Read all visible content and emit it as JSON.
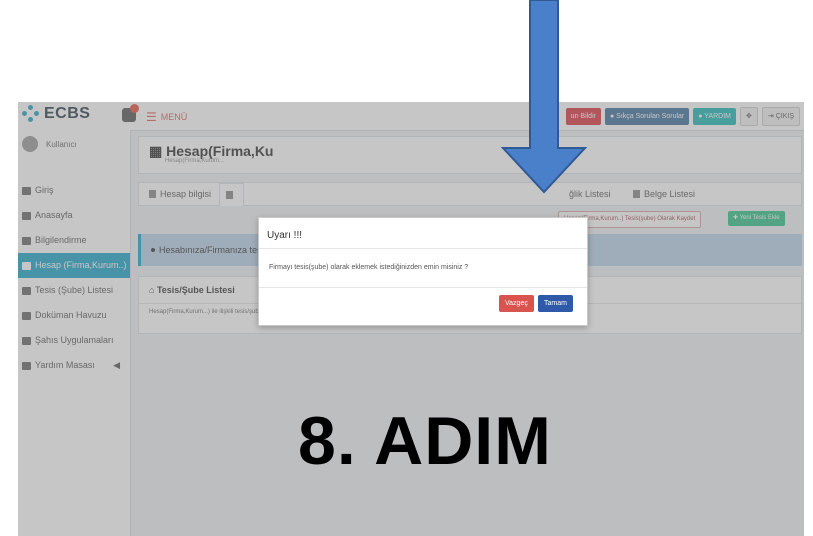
{
  "app": {
    "name": "ECBS",
    "menu_label": "MENÜ"
  },
  "topbar": {
    "buttons": [
      {
        "label": "un Bildir",
        "color": "#d9363e"
      },
      {
        "label": "Sıkça Sorulan Sorular",
        "color": "#3c6f9c"
      },
      {
        "label": "YARDIM",
        "color": "#18b7b4"
      },
      {
        "label": "ÇIKIŞ",
        "color": "#f0f0f0"
      }
    ]
  },
  "sidebar": {
    "user_name": "Kullanıcı",
    "items": [
      {
        "label": "Giriş",
        "icon": "sign-in-icon"
      },
      {
        "label": "Anasayfa",
        "icon": "home-icon"
      },
      {
        "label": "Bilgilendirme",
        "icon": "info-icon"
      },
      {
        "label": "Hesap (Firma,Kurum..)",
        "icon": "account-icon",
        "active": true
      },
      {
        "label": "Tesis (Şube) Listesi",
        "icon": "building-icon"
      },
      {
        "label": "Doküman Havuzu",
        "icon": "document-icon"
      },
      {
        "label": "Şahıs Uygulamaları",
        "icon": "car-icon"
      },
      {
        "label": "Yardım Masası",
        "icon": "envelope-icon",
        "has_caret": true
      }
    ]
  },
  "main": {
    "title": "Hesap(Firma,Ku",
    "subtitle": "Hesap(Firma,Kurum...",
    "tabs": [
      "Hesap bilgisi",
      "",
      "ğlik Listesi",
      "Belge Listesi"
    ],
    "action_outline": "Hesap(Firma,Kurum..) Tesis(şube) Olarak Kaydet",
    "action_green": "Yeni Tesis Ekle",
    "info_text": "Hesabınıza/Firmanıza tesis eklemek sağ üstte bulunan \"Yeni Tesis Ekle\"'ye tıklayınız.",
    "panel_title": "Tesis/Şube Listesi",
    "panel_text": "Hesap(Firma,Kurum...) ile ilişkili tesis/şube bulunmamaktadır."
  },
  "modal": {
    "title": "Uyarı !!!",
    "body": "Firmayı tesis(şube) olarak eklemek istediğinizden emin misiniz ?",
    "cancel_label": "Vazgeç",
    "ok_label": "Tamam"
  },
  "annotation": {
    "step_label": "8. ADIM",
    "arrow_color": "#4a7fc9"
  }
}
